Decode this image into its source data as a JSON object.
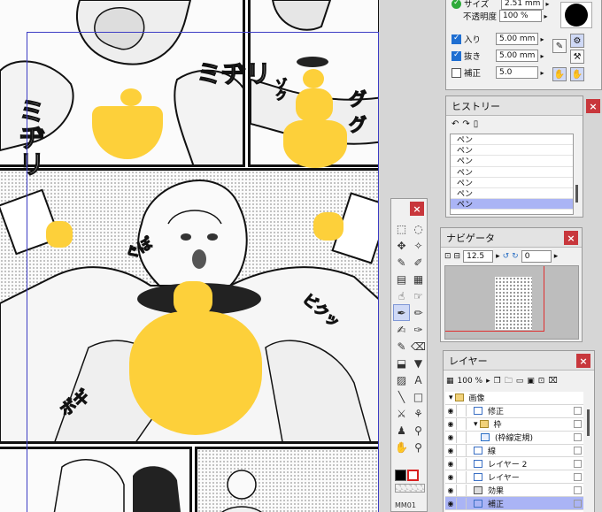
{
  "tool_property": {
    "size_label": "サイズ",
    "size_value": "2.51 mm",
    "opacity_label": "不透明度",
    "opacity_value": "100 %",
    "start_label": "入り",
    "start_value": "5.00 mm",
    "end_label": "抜き",
    "end_value": "5.00 mm",
    "correction_label": "補正",
    "correction_value": "5.0"
  },
  "history": {
    "title": "ヒストリー",
    "items": [
      "ペン",
      "ペン",
      "ペン",
      "ペン",
      "ペン",
      "ペン",
      "ペン"
    ]
  },
  "navigator": {
    "title": "ナビゲータ",
    "zoom_value": "12.5",
    "rotation_value": "0"
  },
  "layer": {
    "title": "レイヤー",
    "opacity_value": "100 %",
    "rows": [
      {
        "name": "画像",
        "indent": 0,
        "type": "folder"
      },
      {
        "name": "修正",
        "indent": 1,
        "type": "raster"
      },
      {
        "name": "枠",
        "indent": 1,
        "type": "folder"
      },
      {
        "name": "(枠線定規)",
        "indent": 2,
        "type": "ruler"
      },
      {
        "name": "線",
        "indent": 1,
        "type": "raster"
      },
      {
        "name": "レイヤー 2",
        "indent": 1,
        "type": "raster"
      },
      {
        "name": "レイヤー",
        "indent": 1,
        "type": "raster"
      },
      {
        "name": "効果",
        "indent": 1,
        "type": "effect"
      },
      {
        "name": "補正",
        "indent": 1,
        "type": "raster",
        "selected": true
      }
    ]
  },
  "canvas": {
    "sfx": [
      "ミヂリ",
      "ミヂリ",
      "ゾク",
      "ググ",
      "ぐぽ",
      "ビクッ",
      "ボギ"
    ],
    "status_text": "MM01"
  },
  "colors": {
    "censor_heart": "#fdd03a",
    "selected_row": "#aab4f5",
    "close_button": "#c8373c",
    "guide_line": "#3c3cc4"
  },
  "icons": {
    "history_undo": "undo-icon",
    "history_redo": "redo-icon",
    "close": "close-icon"
  }
}
